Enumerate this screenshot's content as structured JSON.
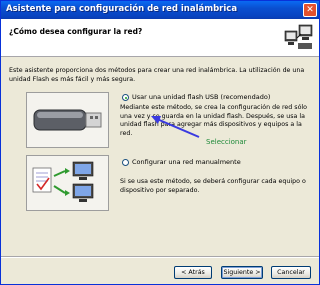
{
  "window": {
    "title": "Asistente para configuración de red inalámbrica"
  },
  "header": {
    "title": "¿Cómo desea configurar la red?"
  },
  "intro": "Este asistente proporciona dos métodos para crear una red inalámbrica. La utilización de una unidad Flash es más fácil y más segura.",
  "options": {
    "usb": {
      "label": "Usar una unidad flash USB (recomendado)",
      "description": "Mediante este método, se crea la configuración de red sólo una vez y se guarda en la unidad flash. Después, se usa la unidad flash para agregar más dispositivos y equipos a la red.",
      "selected": true
    },
    "manual": {
      "label": "Configurar una red manualmente",
      "description": "Si se usa este método, se deberá configurar cada equipo o dispositivo por separado.",
      "selected": false
    }
  },
  "annotation": "Seleccionar",
  "buttons": {
    "back": "< Atrás",
    "next": "Siguiente >",
    "cancel": "Cancelar"
  },
  "colors": {
    "titlebar": "#0a4fd0",
    "annotation": "#1f8a3a",
    "arrow": "#3a3ae0"
  }
}
